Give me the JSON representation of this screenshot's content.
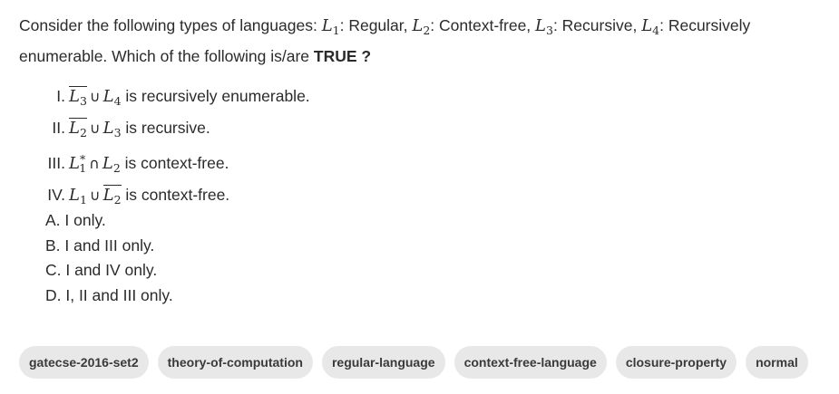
{
  "question": {
    "text_1": "Consider the following types of languages: ",
    "text_2": ": Regular, ",
    "text_3": ": Context-free, ",
    "text_4": ": Recursive, ",
    "text_5": ": Recursively enumerable. Which of the following is/are ",
    "emphasis": "TRUE ?",
    "L": "L",
    "idx_1": "1",
    "idx_2": "2",
    "idx_3": "3",
    "idx_4": "4"
  },
  "statements": [
    {
      "num": "I.",
      "text": " is recursively enumerable."
    },
    {
      "num": "II.",
      "text": " is recursive."
    },
    {
      "num": "III.",
      "text": " is context-free."
    },
    {
      "num": "IV.",
      "text": " is context-free."
    }
  ],
  "symbols": {
    "union": "∪",
    "intersect": "∩",
    "star": "*"
  },
  "options": [
    "A. I only.",
    "B. I and III only.",
    "C. I and IV only.",
    "D. I, II and III only."
  ],
  "tags": [
    "gatecse-2016-set2",
    "theory-of-computation",
    "regular-language",
    "context-free-language",
    "closure-property",
    "normal"
  ]
}
